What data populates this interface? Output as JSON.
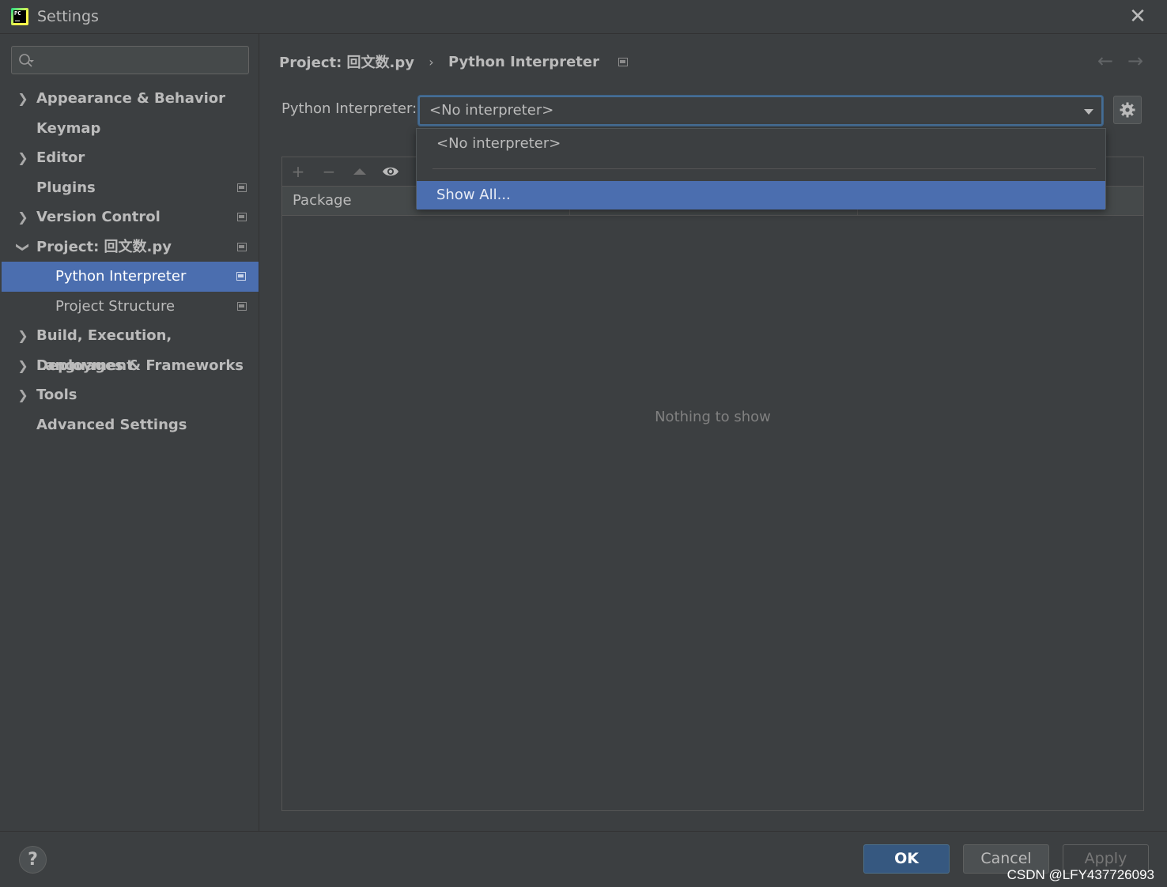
{
  "window": {
    "title": "Settings",
    "app_logo_text": "PC"
  },
  "sidebar": {
    "search": {
      "value": "",
      "placeholder": ""
    },
    "items": [
      {
        "label": "Appearance & Behavior",
        "expandable": true,
        "expanded": false,
        "has_project_icon": false
      },
      {
        "label": "Keymap",
        "expandable": false,
        "has_project_icon": false
      },
      {
        "label": "Editor",
        "expandable": true,
        "expanded": false,
        "has_project_icon": false
      },
      {
        "label": "Plugins",
        "expandable": false,
        "has_project_icon": true
      },
      {
        "label": "Version Control",
        "expandable": true,
        "expanded": false,
        "has_project_icon": true
      },
      {
        "label": "Project: 回文数.py",
        "expandable": true,
        "expanded": true,
        "has_project_icon": true
      },
      {
        "label": "Python Interpreter",
        "child": true,
        "selected": true,
        "has_project_icon": true
      },
      {
        "label": "Project Structure",
        "child": true,
        "has_project_icon": true
      },
      {
        "label": "Build, Execution, Deployment",
        "expandable": true,
        "expanded": false,
        "has_project_icon": false
      },
      {
        "label": "Languages & Frameworks",
        "expandable": true,
        "expanded": false,
        "has_project_icon": false
      },
      {
        "label": "Tools",
        "expandable": true,
        "expanded": false,
        "has_project_icon": false
      },
      {
        "label": "Advanced Settings",
        "expandable": false,
        "has_project_icon": false
      }
    ]
  },
  "content": {
    "breadcrumb": {
      "parent": "Project: 回文数.py",
      "separator": "›",
      "current": "Python Interpreter"
    },
    "interpreter": {
      "label": "Python Interpreter:",
      "value": "<No interpreter>"
    },
    "dropdown": {
      "options": [
        "<No interpreter>",
        "Show All..."
      ],
      "highlighted": "Show All..."
    },
    "packages": {
      "columns": [
        "Package",
        "",
        ""
      ],
      "empty_text": "Nothing to show"
    }
  },
  "footer": {
    "help_label": "?",
    "ok_label": "OK",
    "cancel_label": "Cancel",
    "apply_label": "Apply",
    "watermark": "CSDN @LFY437726093"
  },
  "colors": {
    "background": "#3c3f41",
    "selection": "#4b6eaf",
    "ok_button": "#365880",
    "focus_border": "#466d94"
  }
}
